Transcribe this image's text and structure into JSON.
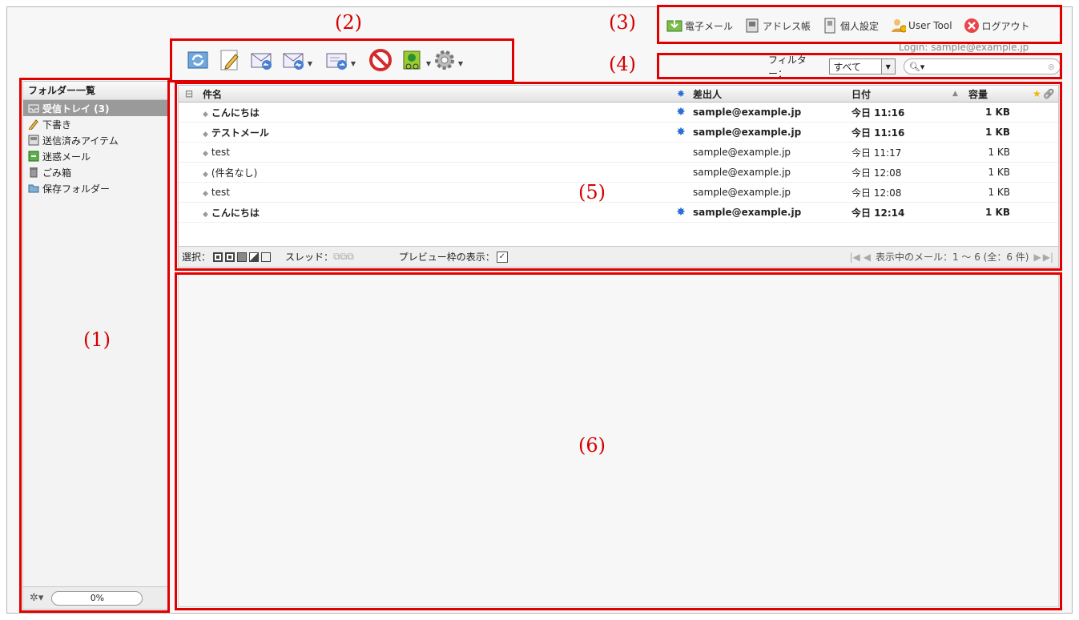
{
  "markers": [
    "(1)",
    "(2)",
    "(3)",
    "(4)",
    "(5)",
    "(6)"
  ],
  "topnav": {
    "items": [
      {
        "label": "電子メール",
        "icon": "mail-download-icon"
      },
      {
        "label": "アドレス帳",
        "icon": "address-book-icon"
      },
      {
        "label": "個人設定",
        "icon": "settings-phone-icon"
      },
      {
        "label": "User Tool",
        "icon": "user-tool-icon"
      },
      {
        "label": "ログアウト",
        "icon": "logout-icon"
      }
    ],
    "login": "Login: sample@example.jp"
  },
  "toolbar": {
    "buttons": [
      {
        "name": "check-mail-button",
        "icon": "refresh-mail-icon"
      },
      {
        "name": "compose-button",
        "icon": "pencil-icon"
      },
      {
        "name": "reply-button",
        "icon": "reply-icon"
      },
      {
        "name": "reply-all-button",
        "icon": "reply-all-icon"
      },
      {
        "name": "forward-button",
        "icon": "forward-icon"
      },
      {
        "name": "delete-button",
        "icon": "delete-icon"
      },
      {
        "name": "mark-button",
        "icon": "mark-icon"
      },
      {
        "name": "more-button",
        "icon": "gear-icon"
      }
    ]
  },
  "filter": {
    "label": "フィルター：",
    "value": "すべて",
    "search_placeholder": ""
  },
  "folders": {
    "title": "フォルダー一覧",
    "items": [
      {
        "label": "受信トレイ (3)",
        "icon": "inbox-icon",
        "selected": true
      },
      {
        "label": "下書き",
        "icon": "pencil-icon",
        "selected": false
      },
      {
        "label": "送信済みアイテム",
        "icon": "sent-icon",
        "selected": false
      },
      {
        "label": "迷惑メール",
        "icon": "junk-icon",
        "selected": false
      },
      {
        "label": "ごみ箱",
        "icon": "trash-icon",
        "selected": false
      },
      {
        "label": "保存フォルダー",
        "icon": "folder-icon",
        "selected": false
      }
    ],
    "quota": "0%"
  },
  "list": {
    "headers": {
      "subject": "件名",
      "from": "差出人",
      "date": "日付",
      "size": "容量"
    },
    "rows": [
      {
        "subject": "こんにちは",
        "from": "sample@example.jp",
        "date": "今日 11:16",
        "size": "1 KB",
        "unread": true
      },
      {
        "subject": "テストメール",
        "from": "sample@example.jp",
        "date": "今日 11:16",
        "size": "1 KB",
        "unread": true
      },
      {
        "subject": "test",
        "from": "sample@example.jp",
        "date": "今日 11:17",
        "size": "1 KB",
        "unread": false
      },
      {
        "subject": "(件名なし)",
        "from": "sample@example.jp",
        "date": "今日 12:08",
        "size": "1 KB",
        "unread": false
      },
      {
        "subject": "test",
        "from": "sample@example.jp",
        "date": "今日 12:08",
        "size": "1 KB",
        "unread": false
      },
      {
        "subject": "こんにちは",
        "from": "sample@example.jp",
        "date": "今日 12:14",
        "size": "1 KB",
        "unread": true
      }
    ],
    "footer": {
      "select_label": "選択：",
      "thread_label": "スレッド：",
      "preview_label": "プレビュー枠の表示：",
      "count_text": "表示中のメール：1 ～ 6 (全：6 件)"
    }
  },
  "colors": {
    "annotation": "#e00000",
    "unread_star": "#2a6fd6"
  }
}
